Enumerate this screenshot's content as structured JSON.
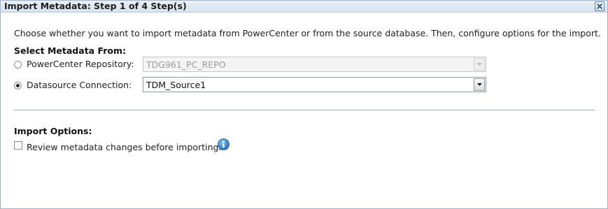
{
  "dialog": {
    "title": "Import Metadata: Step 1 of 4 Step(s)",
    "close_icon": "close-icon"
  },
  "description": "Choose whether you want to import metadata from PowerCenter or from the source database. Then, configure options for the import.",
  "select_section": {
    "label": "Select Metadata From:",
    "options": [
      {
        "label": "PowerCenter Repository:",
        "selected": false,
        "value": "TDG961_PC_REPO",
        "enabled": false
      },
      {
        "label": "Datasource Connection:",
        "selected": true,
        "value": "TDM_Source1",
        "enabled": true
      }
    ]
  },
  "import_options": {
    "label": "Import Options:",
    "review_label": "Review metadata changes before importing.",
    "review_checked": false,
    "info_icon": "info-icon"
  },
  "colors": {
    "titlebar": "#d6e3ee",
    "info_blue": "#2f7fd1"
  }
}
